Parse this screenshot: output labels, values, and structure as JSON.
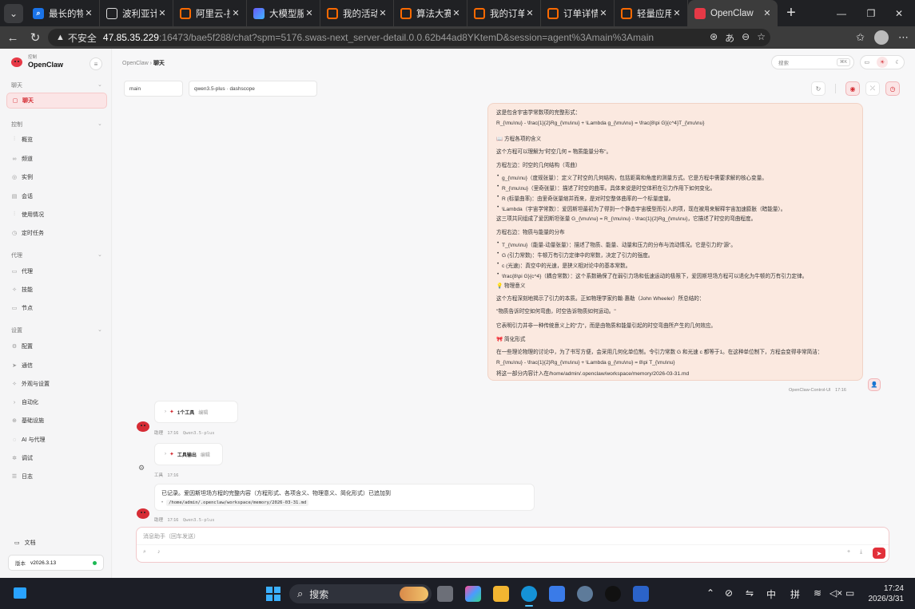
{
  "browser": {
    "tabs": [
      {
        "title": "最长的物理",
        "icon": "search-icon"
      },
      {
        "title": "波利亚计数",
        "icon": "globe-icon"
      },
      {
        "title": "阿里云-搜索",
        "icon": "aliyun-icon"
      },
      {
        "title": "大模型服务",
        "icon": "model-icon"
      },
      {
        "title": "我的活动",
        "icon": "aliyun-icon"
      },
      {
        "title": "算法大赛-",
        "icon": "aliyun-icon"
      },
      {
        "title": "我的订单 -",
        "icon": "aliyun-icon"
      },
      {
        "title": "订单详情（",
        "icon": "aliyun-icon"
      },
      {
        "title": "轻量应用服",
        "icon": "aliyun-icon"
      },
      {
        "title": "OpenClaw",
        "icon": "openclaw-icon",
        "active": true
      }
    ],
    "insecure_label": "不安全",
    "url_host": "47.85.35.229",
    "url_path": ":16473/bae5f288/chat?spm=5176.swas-next_server-detail.0.0.62b44ad8YKtemD&session=agent%3Amain%3Amain"
  },
  "sidebar": {
    "brand_small": "控制",
    "brand_name": "OpenClaw",
    "sections": [
      {
        "label": "聊天",
        "items": [
          {
            "label": "聊天",
            "icon": "chat-icon",
            "active": true
          }
        ]
      },
      {
        "label": "控制",
        "items": [
          {
            "label": "概览",
            "icon": "bar-chart-icon"
          },
          {
            "label": "频道",
            "icon": "link-icon"
          },
          {
            "label": "实例",
            "icon": "radio-icon"
          },
          {
            "label": "会话",
            "icon": "file-icon"
          },
          {
            "label": "使用情况",
            "icon": "bar-chart-icon"
          },
          {
            "label": "定时任务",
            "icon": "clock-icon"
          }
        ]
      },
      {
        "label": "代理",
        "items": [
          {
            "label": "代理",
            "icon": "folder-icon"
          },
          {
            "label": "技能",
            "icon": "sparkle-icon"
          },
          {
            "label": "节点",
            "icon": "monitor-icon"
          }
        ]
      },
      {
        "label": "设置",
        "items": [
          {
            "label": "配置",
            "icon": "gear-icon"
          },
          {
            "label": "通信",
            "icon": "send-icon"
          },
          {
            "label": "外观与设置",
            "icon": "sparkle-icon"
          },
          {
            "label": "自动化",
            "icon": "terminal-icon"
          },
          {
            "label": "基础设施",
            "icon": "globe-icon"
          },
          {
            "label": "AI 与代理",
            "icon": "ai-icon"
          },
          {
            "label": "调试",
            "icon": "bug-icon"
          },
          {
            "label": "日志",
            "icon": "log-icon"
          }
        ]
      }
    ],
    "docs_label": "文档",
    "version_label": "版本",
    "version_value": "v2026.3.13"
  },
  "header": {
    "crumb_parent": "OpenClaw",
    "crumb_sep": "›",
    "crumb_current": "聊天",
    "search_placeholder": "搜索",
    "search_shortcut": "⌘K"
  },
  "selectors": {
    "session": "main",
    "model": "qwen3.5-plus · dashscope"
  },
  "message": {
    "lines": [
      {
        "text": "这是包含宇宙学常数项的完整形式："
      },
      {
        "text": "R_{\\mu\\nu} - \\frac{1}{2}Rg_{\\mu\\nu} + \\Lambda g_{\\mu\\nu} = \\frac{8\\pi G}{c^4}T_{\\mu\\nu}"
      },
      {
        "text": "📖 方程各项的含义"
      },
      {
        "text": "这个方程可以理解为\"时空几何 = 物质能量分布\"。"
      },
      {
        "text": "方程左边：时空的几何结构（弯曲）"
      },
      {
        "text": "g_{\\mu\\nu}（度规张量）：定义了时空的几何结构，包括距离和角度的测量方式。它是方程中需要求解的核心变量。",
        "bullet": true
      },
      {
        "text": "R_{\\mu\\nu}（里奇张量）：描述了时空的曲率。具体来说是时空体积在引力作用下如何变化。",
        "bullet": true
      },
      {
        "text": "R (标量曲率)：由里奇张量缩并而来，是对时空整体曲率的一个标量度量。",
        "bullet": true
      },
      {
        "text": "\\Lambda（宇宙学常数）：爱因斯坦最初为了得到一个静态宇宙模型而引入的项，现在被用来解释宇宙加速膨胀（暗能量）。",
        "bullet": true
      },
      {
        "text": "这三项共同组成了爱因斯坦张量 G_{\\mu\\nu} = R_{\\mu\\nu} - \\frac{1}{2}Rg_{\\mu\\nu}，它描述了时空的弯曲程度。"
      },
      {
        "text": "方程右边：物质与能量的分布"
      },
      {
        "text": "T_{\\mu\\nu}（能量-动量张量）：描述了物质、能量、动量和压力的分布与流动情况。它是引力的\"源\"。",
        "bullet": true
      },
      {
        "text": "G (引力常数)：牛顿万有引力定律中的常数，决定了引力的强度。",
        "bullet": true
      },
      {
        "text": "c (光速)：真空中的光速，是狭义相对论中的基本常数。",
        "bullet": true
      },
      {
        "text": "\\frac{8\\pi G}{c^4}（耦合常数）：这个系数确保了在弱引力场和低速运动的极限下，爱因斯坦场方程可以退化为牛顿的万有引力定律。",
        "bullet": true
      },
      {
        "text": "💡 物理意义"
      },
      {
        "text": "这个方程深刻地揭示了引力的本质。正如物理学家约翰·惠勒（John Wheeler）所总结的："
      },
      {
        "text": "\"物质告诉时空如何弯曲，时空告诉物质如何运动。\""
      },
      {
        "text": "它表明引力并非一种传统意义上的\"力\"，而是由物质和能量引起的时空弯曲所产生的几何效应。"
      },
      {
        "text": "🎀 简化形式"
      },
      {
        "text": "在一些理论物理的讨论中，为了书写方便，会采用几何化单位制。令引力常数 G 和光速 c 都等于1。在这种单位制下，方程会变得非常简洁："
      },
      {
        "text": "R_{\\mu\\nu} - \\frac{1}{2}Rg_{\\mu\\nu} + \\Lambda g_{\\mu\\nu} = 8\\pi T_{\\mu\\nu}"
      },
      {
        "text": "将这一部分内容计入在/home/admin/.openclaw/workspace/memory/2026-03-31.md"
      }
    ],
    "sender": "OpenClaw-Control-UI",
    "time": "17:16"
  },
  "tool_call": {
    "count_label": "1个工具",
    "edit_label": "编辑",
    "sender": "助理",
    "time": "17:16",
    "model": "Qwen3.5-plus"
  },
  "tool_output": {
    "label": "工具输出",
    "edit_label": "编辑",
    "sender": "工具",
    "time": "17:16"
  },
  "reply": {
    "text": "已记录。爱因斯坦场方程的完整内容（方程形式、各项含义、物理意义、简化形式）已追加到",
    "path": "/home/admin/.openclaw/workspace/memory/2026-03-31.md",
    "sender": "助理",
    "time": "17:16",
    "model": "Qwen3.5-plus"
  },
  "composer": {
    "placeholder": "消息助手（回车发送）"
  },
  "taskbar": {
    "search_label": "搜索",
    "ime_label": "中",
    "ime_mode": "拼",
    "time": "17:24",
    "date": "2026/3/31"
  }
}
